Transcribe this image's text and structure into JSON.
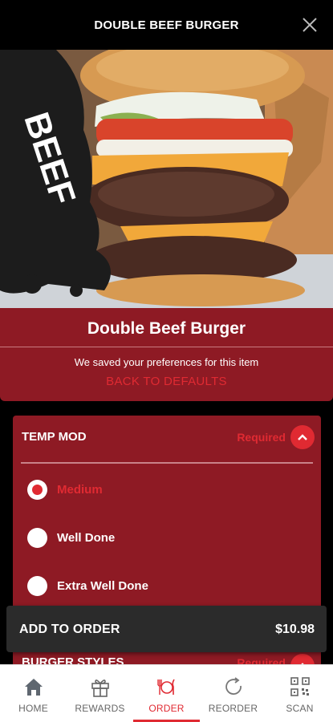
{
  "header": {
    "title": "DOUBLE BEEF BURGER"
  },
  "hero": {
    "badge_text": "BEEF"
  },
  "item": {
    "name": "Double Beef Burger",
    "saved_message": "We saved your preferences for this item",
    "back_to_defaults": "BACK TO DEFAULTS"
  },
  "modifier": {
    "title": "TEMP MOD",
    "required_label": "Required",
    "options": [
      {
        "label": "Medium",
        "selected": true
      },
      {
        "label": "Well Done",
        "selected": false
      },
      {
        "label": "Extra Well Done",
        "selected": false
      }
    ]
  },
  "next_modifier": {
    "title": "BURGER STYLES",
    "required_label": "Required"
  },
  "add_to_order": {
    "label": "ADD TO ORDER",
    "price": "$10.98"
  },
  "nav": {
    "items": [
      {
        "label": "HOME",
        "icon": "home-icon",
        "active": false
      },
      {
        "label": "REWARDS",
        "icon": "gift-icon",
        "active": false
      },
      {
        "label": "ORDER",
        "icon": "plate-icon",
        "active": true
      },
      {
        "label": "REORDER",
        "icon": "refresh-icon",
        "active": false
      },
      {
        "label": "SCAN",
        "icon": "qr-code-icon",
        "active": false
      }
    ]
  },
  "colors": {
    "brand_red": "#8e1a24",
    "accent_red": "#e02a32",
    "bar_dark": "#2b2b2b"
  }
}
